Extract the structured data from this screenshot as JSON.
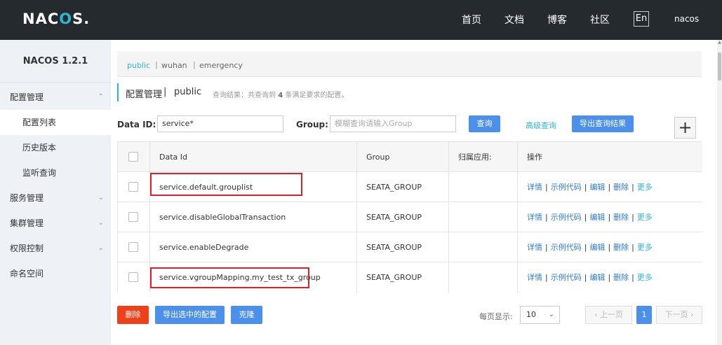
{
  "header": {
    "logo_text": "NAC",
    "logo_o": "O",
    "logo_rest": "S.",
    "nav": [
      "首页",
      "文档",
      "博客",
      "社区"
    ],
    "lang": "En",
    "user": "nacos"
  },
  "sidebar": {
    "brand": "NACOS 1.2.1",
    "items": [
      {
        "label": "配置管理",
        "chevron": "^"
      },
      {
        "label": "配置列表"
      },
      {
        "label": "历史版本"
      },
      {
        "label": "监听查询"
      },
      {
        "label": "服务管理",
        "chevron": "v"
      },
      {
        "label": "集群管理",
        "chevron": "v"
      },
      {
        "label": "权限控制",
        "chevron": "v"
      },
      {
        "label": "命名空间"
      }
    ]
  },
  "namespaces": {
    "items": [
      "public",
      "wuhan",
      "emergency"
    ],
    "separator": "|"
  },
  "page": {
    "title": "配置管理",
    "title_sep": "|",
    "namespace": "public",
    "result_prefix": "查询结果：共查询到",
    "result_count": "4",
    "result_suffix": "条满足要求的配置。"
  },
  "search": {
    "data_id_label": "Data ID:",
    "data_id_value": "service*",
    "group_label": "Group:",
    "group_placeholder": "模糊查询请输入Group",
    "query_button": "查询",
    "advanced_link": "高级查询",
    "export_button": "导出查询结果",
    "add_button": "+"
  },
  "table": {
    "headers": [
      "Data Id",
      "Group",
      "归属应用:",
      "操作"
    ],
    "rows": [
      {
        "data_id": "service.default.grouplist",
        "group": "SEATA_GROUP",
        "app": ""
      },
      {
        "data_id": "service.disableGlobalTransaction",
        "group": "SEATA_GROUP",
        "app": ""
      },
      {
        "data_id": "service.enableDegrade",
        "group": "SEATA_GROUP",
        "app": ""
      },
      {
        "data_id": "service.vgroupMapping.my_test_tx_group",
        "group": "SEATA_GROUP",
        "app": ""
      }
    ],
    "ops": {
      "detail": "详情",
      "sample": "示例代码",
      "edit": "编辑",
      "delete": "删除",
      "more": "更多",
      "sep": "|"
    }
  },
  "footer": {
    "delete_button": "删除",
    "export_selected_button": "导出选中的配置",
    "clone_button": "克隆",
    "page_size_label": "每页显示:",
    "page_size": "10",
    "prev": "上一页",
    "current_page": "1",
    "next": "下一页"
  },
  "colors": {
    "accent": "#2fb5d6",
    "primary_button": "#4a90ec",
    "danger_button": "#f0401a",
    "highlight_box": "#d9232b",
    "header_bg": "#252a2f"
  }
}
